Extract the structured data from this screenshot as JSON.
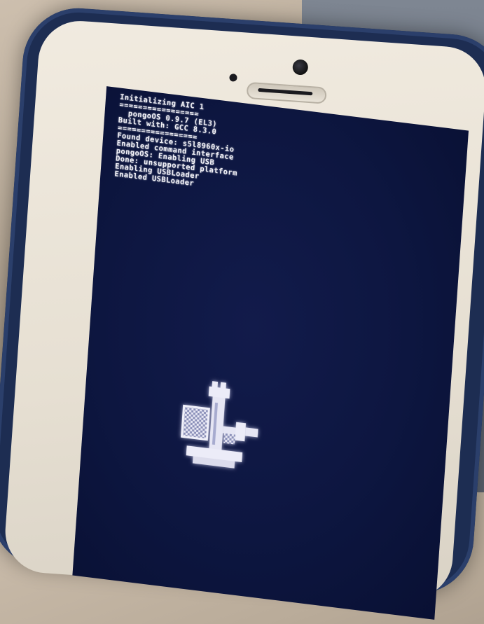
{
  "screen": {
    "log_lines": [
      "Initializing AIC 1",
      "=================",
      "  pongoOS 0.9.7 (EL3)",
      "Built with: GCC 8.3.0",
      "=================",
      "Found device: s5l8960x-io",
      "Enabled command interface",
      "pongoOS: Enabling USB",
      "Done: unsupported platform",
      "Enabling USBLoader",
      "Enabled USBLoader"
    ],
    "colors": {
      "background": "#0d1640",
      "text": "#f2f2f8",
      "bezel": "#e6dfd2",
      "case": "#1d2d52"
    },
    "logo_icon": "chess-rook-logo-icon"
  }
}
